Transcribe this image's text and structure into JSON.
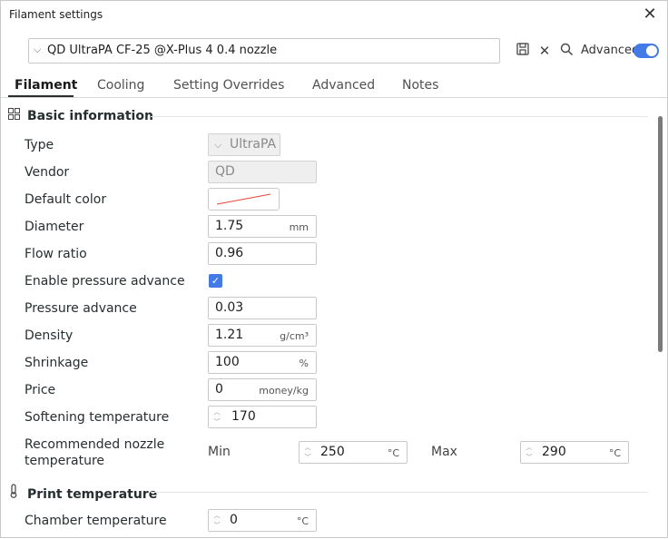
{
  "window": {
    "title": "Filament settings",
    "close_icon": "close-icon"
  },
  "preset": {
    "value": "QD UltraPA CF-25 @X-Plus 4 0.4 nozzle"
  },
  "toolbar": {
    "advanced_label": "Advanced",
    "advanced_on": true
  },
  "tabs": [
    {
      "label": "Filament",
      "active": true
    },
    {
      "label": "Cooling"
    },
    {
      "label": "Setting Overrides"
    },
    {
      "label": "Advanced"
    },
    {
      "label": "Notes"
    }
  ],
  "sections": {
    "basic": "Basic information",
    "print_temp": "Print temperature"
  },
  "basic": {
    "type": {
      "label": "Type",
      "value": "UltraPA"
    },
    "vendor": {
      "label": "Vendor",
      "value": "QD"
    },
    "default_color": {
      "label": "Default color"
    },
    "diameter": {
      "label": "Diameter",
      "value": "1.75",
      "unit": "mm"
    },
    "flow_ratio": {
      "label": "Flow ratio",
      "value": "0.96"
    },
    "enable_pa": {
      "label": "Enable pressure advance",
      "checked": true
    },
    "pressure_advance": {
      "label": "Pressure advance",
      "value": "0.03"
    },
    "density": {
      "label": "Density",
      "value": "1.21",
      "unit": "g/cm³"
    },
    "shrinkage": {
      "label": "Shrinkage",
      "value": "100",
      "unit": "%"
    },
    "price": {
      "label": "Price",
      "value": "0",
      "unit": "money/kg"
    },
    "softening": {
      "label": "Softening temperature",
      "value": "170"
    },
    "nozzle_temp": {
      "label": "Recommended nozzle temperature",
      "min_label": "Min",
      "min_value": "250",
      "max_label": "Max",
      "max_value": "290",
      "unit": "°C"
    }
  },
  "print_temperature": {
    "chamber": {
      "label": "Chamber temperature",
      "value": "0",
      "unit": "°C"
    }
  },
  "colors": {
    "accent": "#4479e8",
    "swatch_line": "#e8412f"
  }
}
